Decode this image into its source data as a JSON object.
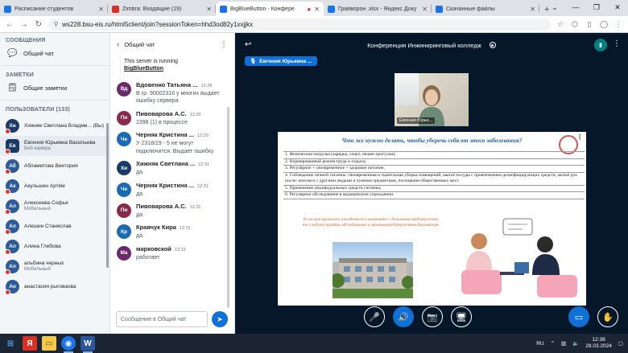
{
  "browser": {
    "tabs": [
      {
        "title": "Расписание студентов",
        "favicon_color": "#1a73e8"
      },
      {
        "title": "Zimbra: Входящие (19)",
        "favicon_color": "#d93025"
      },
      {
        "title": "BigBlueButton - Конфере",
        "favicon_color": "#1a73e8",
        "active": true
      },
      {
        "title": "Грайворон .xlsx - Яндекс Доку",
        "favicon_color": "#1a73e8"
      },
      {
        "title": "Скачанные файлы",
        "favicon_color": "#1a73e8"
      }
    ],
    "url": "ws228.bsu-eis.ru/html5client/join?sessionToken=hhd3od82y1xxjjkx"
  },
  "userlist": {
    "messages_header": "СООБЩЕНИЯ",
    "public_chat": "Общий чат",
    "notes_header": "ЗАМЕТКИ",
    "shared_notes": "Общие заметки",
    "users_header": "ПОЛЬЗОВАТЕЛИ (133)",
    "users": [
      {
        "initials": "Хи",
        "name": "Хижняк Светлана Владми... (Вы)",
        "sub": "",
        "color": "#1a3a6a"
      },
      {
        "initials": "Ев",
        "name": "Евгения Юрьевна Васильева",
        "sub": "Веб-камера",
        "color": "#1a3a6a",
        "square": true,
        "selected": true
      },
      {
        "initials": "Аб",
        "name": "Абламитова Виктория",
        "sub": "",
        "color": "#2e5c9a"
      },
      {
        "initials": "Ак",
        "name": "Акульшин Артём",
        "sub": "",
        "color": "#2e5c9a"
      },
      {
        "initials": "Ал",
        "name": "Алексеева Софья",
        "sub": "Мобильный",
        "color": "#2e5c9a"
      },
      {
        "initials": "Ал",
        "name": "Алешин Станислав",
        "sub": "",
        "color": "#2e5c9a"
      },
      {
        "initials": "Ал",
        "name": "Алина Глебова",
        "sub": "",
        "color": "#2e5c9a"
      },
      {
        "initials": "Ал",
        "name": "альбина черных",
        "sub": "Мобильный",
        "color": "#2e5c9a"
      },
      {
        "initials": "Ан",
        "name": "анастасия рыговаова",
        "sub": "",
        "color": "#2e5c9a"
      }
    ]
  },
  "chat": {
    "title": "Общий чат",
    "server_msg": "This server is running",
    "server_link": "BigBlueButton",
    "messages": [
      {
        "initials": "Вд",
        "name": "Вдовенко Татьяна ...",
        "time": "12:28",
        "text": "В гр. 90002316 у многих выдает ошибку сервера",
        "color": "#6a2a6a"
      },
      {
        "initials": "Пи",
        "name": "Пивоварова А.С.",
        "time": "12:29",
        "text": "2398 (1) в процессе",
        "color": "#8a2a4a"
      },
      {
        "initials": "Че",
        "name": "Черняк Кристина ...",
        "time": "12:29",
        "text": "У 2318/19 - 5 не могут подключится. Выдает ошибку",
        "color": "#1a6ab5"
      },
      {
        "initials": "Хи",
        "name": "Хижняк Светлана ...",
        "time": "12:31",
        "text": "да",
        "color": "#1a3a6a"
      },
      {
        "initials": "Че",
        "name": "Черняк Кристина ...",
        "time": "12:31",
        "text": "да",
        "color": "#1a6ab5"
      },
      {
        "initials": "Пи",
        "name": "Пивоварова А.С.",
        "time": "12:31",
        "text": "да",
        "color": "#8a2a4a"
      },
      {
        "initials": "Кр",
        "name": "Кравчук Кира",
        "time": "12:31",
        "text": "да",
        "color": "#1a6ab5"
      },
      {
        "initials": "Ма",
        "name": "марковской",
        "time": "12:32",
        "text": "работает",
        "color": "#6a2a6a"
      }
    ],
    "input_placeholder": "Сообщение в Общий чат"
  },
  "main": {
    "title": "Конференция Инжиниринговый колледж",
    "talker": "Евгения Юрьевна ...",
    "webcam_label": "Евгения Юрье...",
    "slide": {
      "title": "Что же нужно делать, чтобы уберечь себя от этого заболевания?",
      "items": [
        "1. Физическая нагрузка (зарядка, спорт, пешие прогулки);",
        "2. Нормированный режим труда и отдыха;",
        "3. Регулярное + своевременное + здоровое питание;",
        "4. Соблюдение личной гигиены: своевременная и тщательная уборка помещений, мытьё посуды с привлечением дезинфицирующих средств, мытьё рук после: контакта с другими людьми и чужими предметами, посещения общественных мест.",
        "5. Применение индивидуальных средств гигиены;",
        "6. Регулярное обследование в медицинском учреждении."
      ],
      "note": "Если вам пришлось находиться в контакте с больными туберкулезом, то следует пройти обследование в противотуберкулезном диспансере."
    }
  },
  "taskbar": {
    "lang": "RU",
    "time": "12:38",
    "date": "28.03.2024"
  }
}
